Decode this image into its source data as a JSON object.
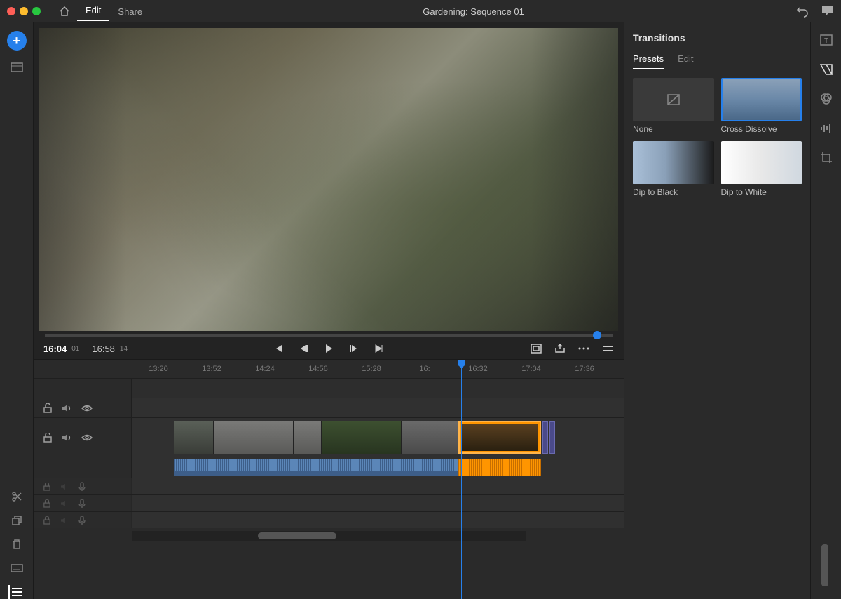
{
  "menu": {
    "edit": "Edit",
    "share": "Share",
    "title": "Gardening: Sequence 01"
  },
  "player": {
    "currentTime": "16:04",
    "currentFrames": "01",
    "totalTime": "16:58",
    "totalFrames": "14"
  },
  "ruler": {
    "t0": "13:20",
    "t1": "13:52",
    "t2": "14:24",
    "t3": "14:56",
    "t4": "15:28",
    "t5": "16:",
    "t6": "16:32",
    "t7": "17:04",
    "t8": "17:36"
  },
  "panel": {
    "title": "Transitions",
    "tabPresets": "Presets",
    "tabEdit": "Edit",
    "items": {
      "none": "None",
      "crossDissolve": "Cross Dissolve",
      "dipBlack": "Dip to Black",
      "dipWhite": "Dip to White"
    }
  }
}
